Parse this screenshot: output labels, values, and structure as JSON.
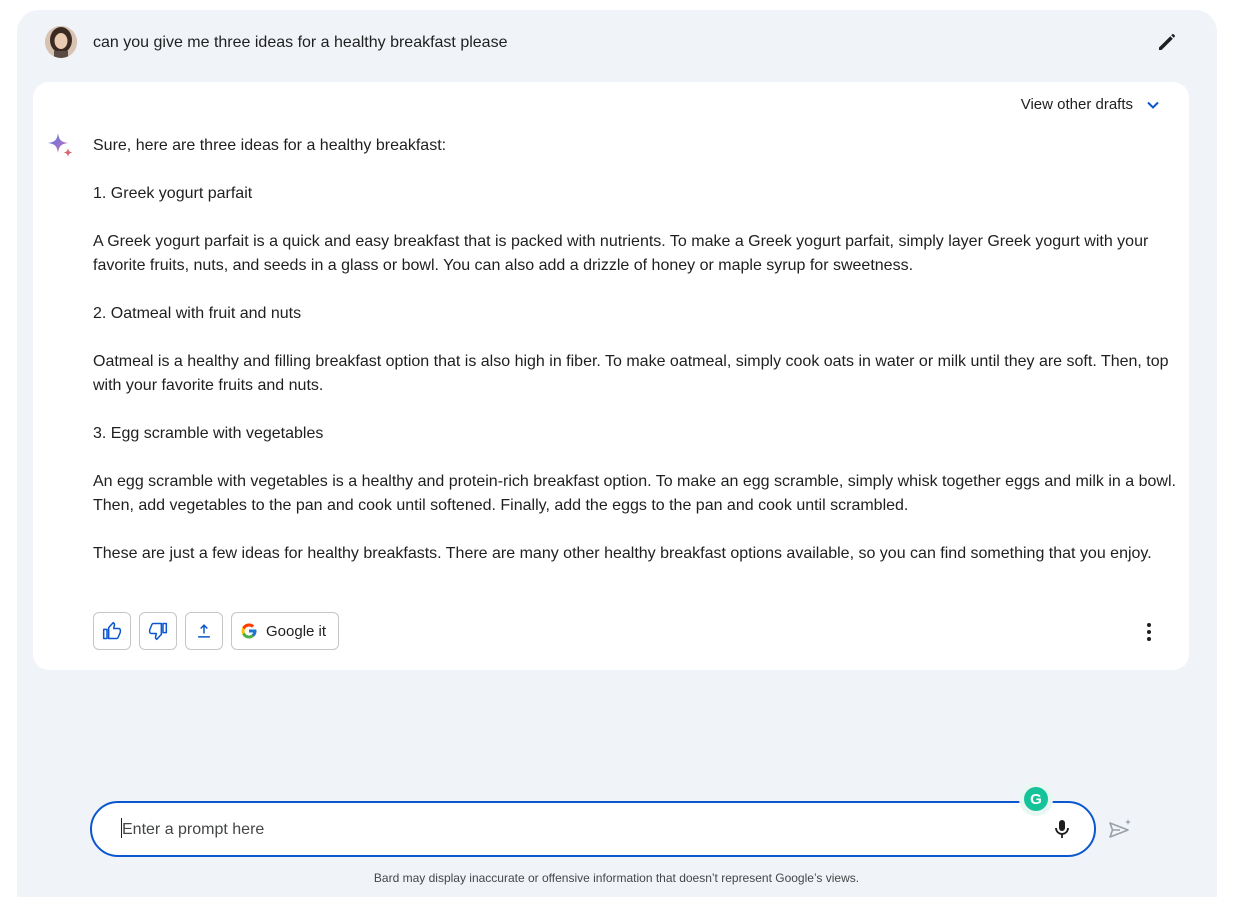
{
  "query": {
    "text": "can you give me three ideas for a healthy breakfast please",
    "edit_icon": "pencil-icon"
  },
  "response": {
    "view_drafts_label": "View other drafts",
    "intro": "Sure, here are three ideas for a healthy breakfast:",
    "items": [
      {
        "heading": "1. Greek yogurt parfait",
        "body": "A Greek yogurt parfait is a quick and easy breakfast that is packed with nutrients. To make a Greek yogurt parfait, simply layer Greek yogurt with your favorite fruits, nuts, and seeds in a glass or bowl. You can also add a drizzle of honey or maple syrup for sweetness."
      },
      {
        "heading": "2. Oatmeal with fruit and nuts",
        "body": "Oatmeal is a healthy and filling breakfast option that is also high in fiber. To make oatmeal, simply cook oats in water or milk until they are soft. Then, top with your favorite fruits and nuts."
      },
      {
        "heading": "3. Egg scramble with vegetables",
        "body": "An egg scramble with vegetables is a healthy and protein-rich breakfast option. To make an egg scramble, simply whisk together eggs and milk in a bowl. Then, add vegetables to the pan and cook until softened. Finally, add the eggs to the pan and cook until scrambled."
      }
    ],
    "outro": "These are just a few ideas for healthy breakfasts. There are many other healthy breakfast options available, so you can find something that you enjoy.",
    "actions": {
      "google_it_label": "Google it"
    }
  },
  "prompt": {
    "placeholder": "Enter a prompt here"
  },
  "disclaimer": "Bard may display inaccurate or offensive information that doesn’t represent Google’s views.",
  "colors": {
    "panel_bg": "#f0f4f9",
    "accent_blue": "#0b57d0",
    "grammarly_green": "#15c39a"
  }
}
